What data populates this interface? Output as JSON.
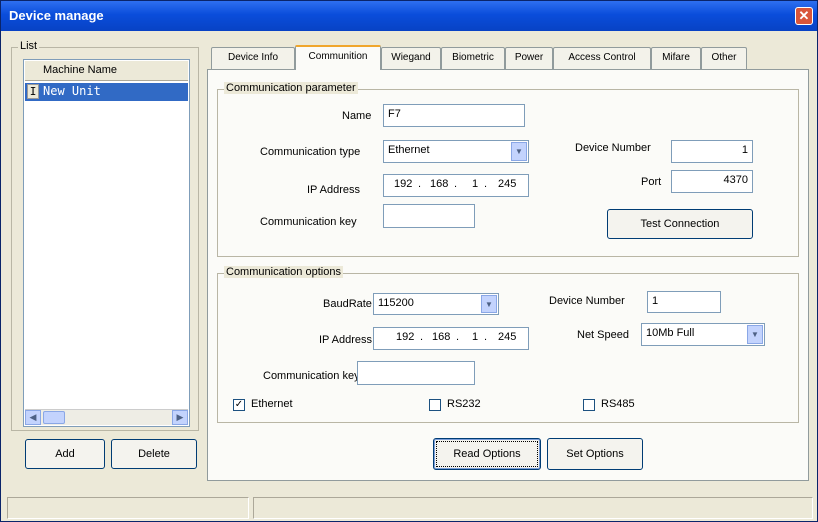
{
  "window": {
    "title": "Device manage",
    "close_glyph": "✕"
  },
  "list": {
    "group_label": "List",
    "column_header": "Machine Name",
    "rows": [
      {
        "marker": "I",
        "name": "New Unit"
      }
    ],
    "scroll_left": "◀",
    "scroll_right": "▶"
  },
  "list_buttons": {
    "add": "Add",
    "delete": "Delete"
  },
  "tabs": [
    {
      "label": "Device Info"
    },
    {
      "label": "Communition"
    },
    {
      "label": "Wiegand"
    },
    {
      "label": "Biometric"
    },
    {
      "label": "Power"
    },
    {
      "label": "Access Control"
    },
    {
      "label": "Mifare"
    },
    {
      "label": "Other"
    }
  ],
  "comm_param": {
    "group_label": "Communication parameter",
    "name_label": "Name",
    "name_value": "F7",
    "type_label": "Communication type",
    "type_value": "Ethernet",
    "ip_label": "IP Address",
    "ip": [
      "192",
      "168",
      "1",
      "245"
    ],
    "key_label": "Communication key",
    "key_value": "",
    "device_number_label": "Device Number",
    "device_number_value": "1",
    "port_label": "Port",
    "port_value": "4370",
    "test_button": "Test Connection"
  },
  "comm_options": {
    "group_label": "Communication options",
    "baudrate_label": "BaudRate",
    "baudrate_value": "115200",
    "ip_label": "IP Address",
    "ip": [
      "192",
      "168",
      "1",
      "245"
    ],
    "key_label": "Communication key",
    "key_value": "",
    "device_number_label": "Device Number",
    "device_number_value": "1",
    "netspeed_label": "Net Speed",
    "netspeed_value": "10Mb Full",
    "checkboxes": [
      {
        "label": "Ethernet",
        "checked": true,
        "mark": "✓"
      },
      {
        "label": "RS232",
        "checked": false,
        "mark": ""
      },
      {
        "label": "RS485",
        "checked": false,
        "mark": ""
      }
    ]
  },
  "actions": {
    "read": "Read Options",
    "set": "Set Options"
  },
  "dropdown_glyph": "▼",
  "colors": {
    "titlebar": "#0a4ddb",
    "selection": "#316ac5",
    "tab_highlight": "#f0a62c"
  }
}
